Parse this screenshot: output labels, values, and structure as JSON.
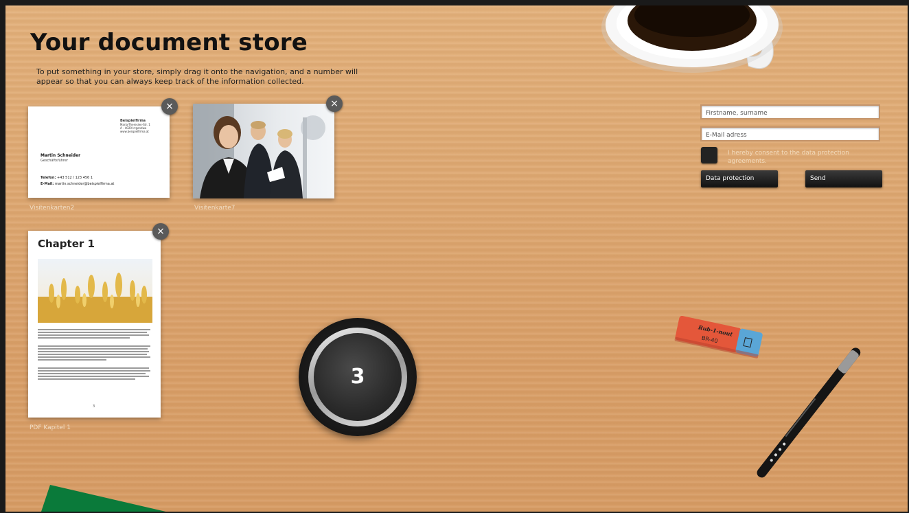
{
  "page": {
    "title": "Your document store",
    "intro": "To put something in your store, simply drag it onto the navigation, and a number will appear so that you can always keep track of the information collected."
  },
  "cards": {
    "business_card": {
      "close": "×",
      "company": "Beispielfirma",
      "company_lines": [
        "Maria-Theresien-Str. 1",
        "A - 4020 Irrgendwo",
        "www.beispielfirma.at"
      ],
      "person_name": "Martin Schneider",
      "person_role": "Geschäftsführer",
      "telefon_label": "Telefon:",
      "telefon_value": "+43 512 / 123 456 1",
      "email_label": "E-Mail:",
      "email_value": "martin.schneider@beispielfirma.at",
      "caption": "Visitenkarten2"
    },
    "photo_card": {
      "close": "×",
      "caption": "Visitenkarte7"
    },
    "pdf_card": {
      "close": "×",
      "heading": "Chapter 1",
      "page_number": "3",
      "caption": "PDF Kapitel 1"
    }
  },
  "form": {
    "name_placeholder": "Firstname, surname",
    "email_placeholder": "E-Mail adress",
    "consent_text": "I hereby consent to the data protection agreements.",
    "data_protection_label": "Data protection",
    "send_label": "Send"
  },
  "counter": {
    "value": "3"
  },
  "desk_items": {
    "eraser_text_1": "Rub-1-nout",
    "eraser_text_2": "BR-40"
  },
  "colors": {
    "desk": "#dda771",
    "accent_green": "#0a7a3a",
    "button_dark": "#1a1a1a"
  }
}
